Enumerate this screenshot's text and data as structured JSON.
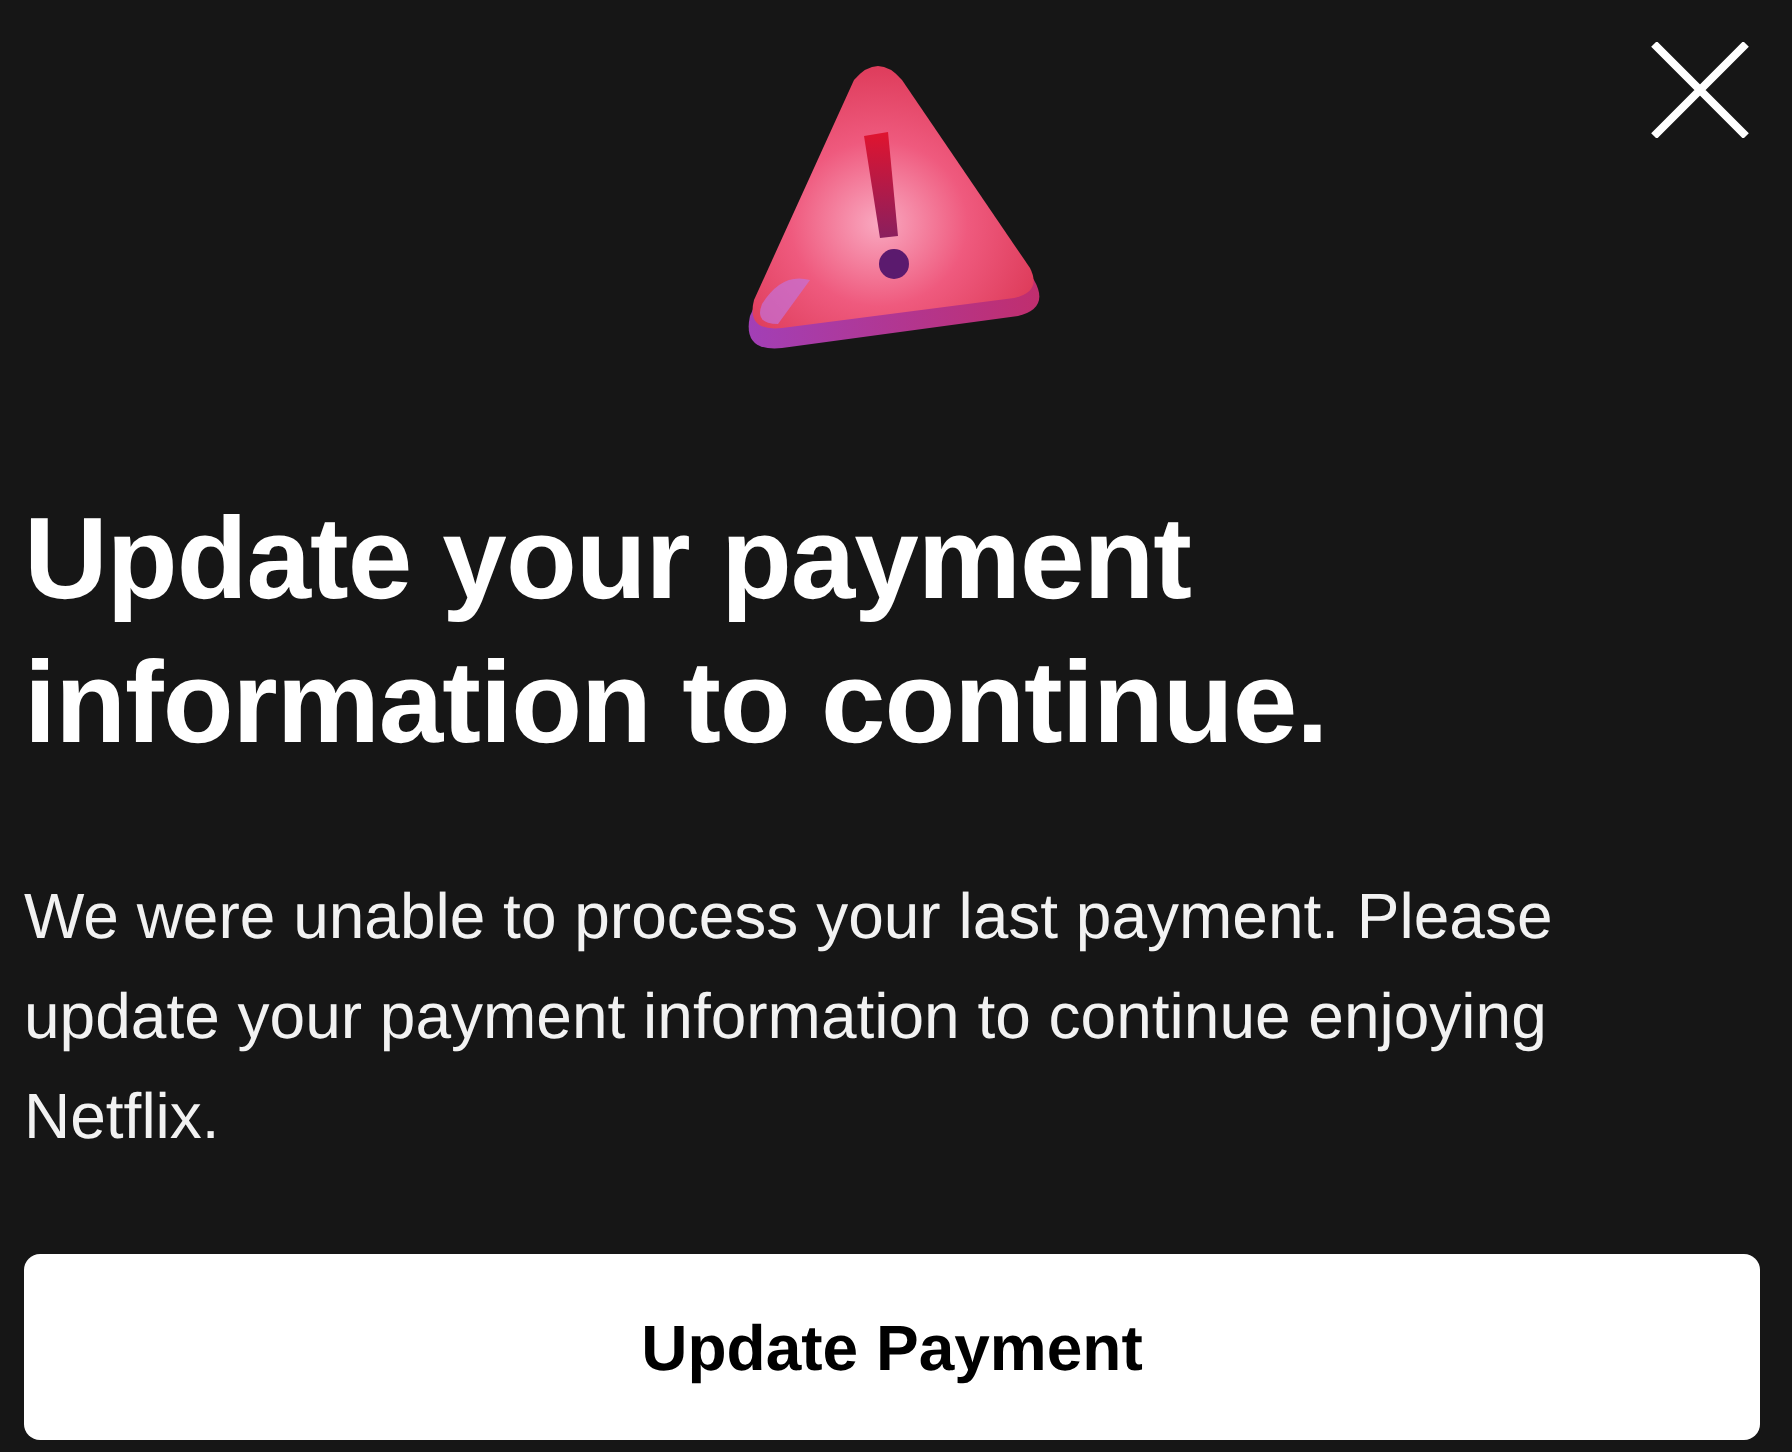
{
  "dialog": {
    "title": "Update your payment information to continue.",
    "message": "We were unable to process your last payment. Please update your payment information to continue enjoying Netflix.",
    "primary_button": {
      "label": "Update Payment"
    }
  }
}
